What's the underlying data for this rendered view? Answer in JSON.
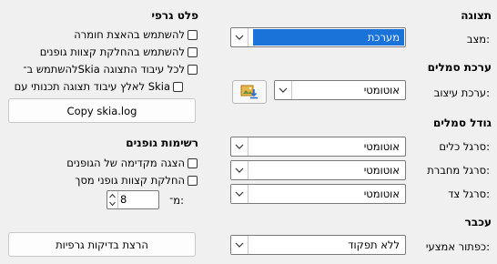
{
  "display": {
    "heading": "תצוגה",
    "mode_label": "מצב:",
    "mode_value": "מערכת"
  },
  "icon_theme": {
    "heading": "ערכת סמלים",
    "style_label": "ערכת עיצוב:",
    "style_value": "אוטומטי",
    "icon": "image-download-icon"
  },
  "icon_size": {
    "heading": "גודל סמלים",
    "toolbar_label": "סרגל כלים:",
    "toolbar_value": "אוטומטי",
    "notebookbar_label": "סרגל מחברת:",
    "notebookbar_value": "אוטומטי",
    "sidebar_label": "סרגל צד:",
    "sidebar_value": "אוטומטי"
  },
  "mouse": {
    "heading": "עכבר",
    "middle_button_label": "כפתור אמצעי:",
    "middle_button_value": "ללא תפקוד"
  },
  "graphics": {
    "heading": "פלט גרפי",
    "checkboxes": [
      {
        "label": "להשתמש בהאצת חומרה",
        "checked": false
      },
      {
        "label": "להשתמש בהחלקת קצוות גופנים",
        "checked": false
      },
      {
        "label": "להשתמש ב־Skia לכל עיבוד התצוגה",
        "checked": false
      },
      {
        "label": "לאלץ עיבוד תצוגה תכנותי עם Skia",
        "checked": false
      }
    ],
    "copy_button": "Copy skia.log"
  },
  "font_lists": {
    "heading": "רשימות גופנים",
    "checkboxes": [
      {
        "label": "הצגה מקדימה של הגופנים",
        "checked": false
      },
      {
        "label": "החלקת קצוות גופני מסך",
        "checked": false
      }
    ],
    "from_label": "מ־:",
    "from_value": "8"
  },
  "run_tests_button": "הרצת בדיקות גרפיות",
  "colors": {
    "selection": "#1a73d9",
    "window": "#f0f0f0"
  }
}
